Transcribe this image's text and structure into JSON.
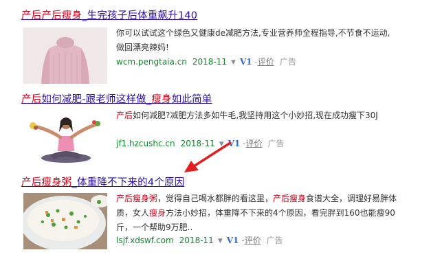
{
  "results": [
    {
      "title_parts": [
        {
          "text": "产后产后瘦身",
          "hl": true
        },
        {
          "text": "_生完孩子后体重飙升140",
          "hl": false
        }
      ],
      "snippet_parts": [
        {
          "text": "你可以试试这个绿色又健康de减肥方法,专业营养师全程指导,不节食不运动,做回漂亮辣妈!",
          "hl": false
        }
      ],
      "url": "wcm.pengtaia.cn",
      "date": "2018-11",
      "v1": "V1",
      "sep": "-",
      "review": "评价",
      "ad": "广告",
      "thumb": "sweater-photo"
    },
    {
      "title_parts": [
        {
          "text": "产后",
          "hl": true
        },
        {
          "text": "如何减肥-跟老师这样做_",
          "hl": false
        },
        {
          "text": "瘦身",
          "hl": true
        },
        {
          "text": "如此简单",
          "hl": false
        }
      ],
      "snippet_parts": [
        {
          "text": "产后",
          "hl": true
        },
        {
          "text": "如何减肥?减肥方法多如牛毛,我坚持用这个小妙招,现在成功瘦下30J",
          "hl": false
        }
      ],
      "url": "jf1.hzcushc.cn",
      "date": "2018-11",
      "v1": "V1",
      "sep": "-",
      "review": "评价",
      "ad": "广告",
      "thumb": "yoga-woman-photo"
    },
    {
      "title_parts": [
        {
          "text": "产后瘦身粥",
          "hl": true
        },
        {
          "text": "_体重降不下来的4个原因",
          "hl": false
        }
      ],
      "snippet_parts": [
        {
          "text": "产后瘦身粥",
          "hl": true
        },
        {
          "text": "，觉得自己喝水都胖的看这里，",
          "hl": false
        },
        {
          "text": "产后瘦身",
          "hl": true
        },
        {
          "text": "食谱大全，调理好易胖体质，女人",
          "hl": false
        },
        {
          "text": "瘦身",
          "hl": true
        },
        {
          "text": "方法小妙招，体重降不下来的4个原因，看完胖到160也能瘦90斤，一个帮助9万肥..",
          "hl": false
        }
      ],
      "url": "lsjf.xdswf.com",
      "date": "2018-11",
      "v1": "V1",
      "sep": "-",
      "review": "评价",
      "ad": "广告",
      "thumb": "porridge-bowl-photo"
    }
  ],
  "colors": {
    "title_link": "#2a0ea6",
    "highlight": "#d0021b",
    "url_green": "#118a2b",
    "v1_blue": "#2f6cc8",
    "arrow_red": "#e02020"
  }
}
